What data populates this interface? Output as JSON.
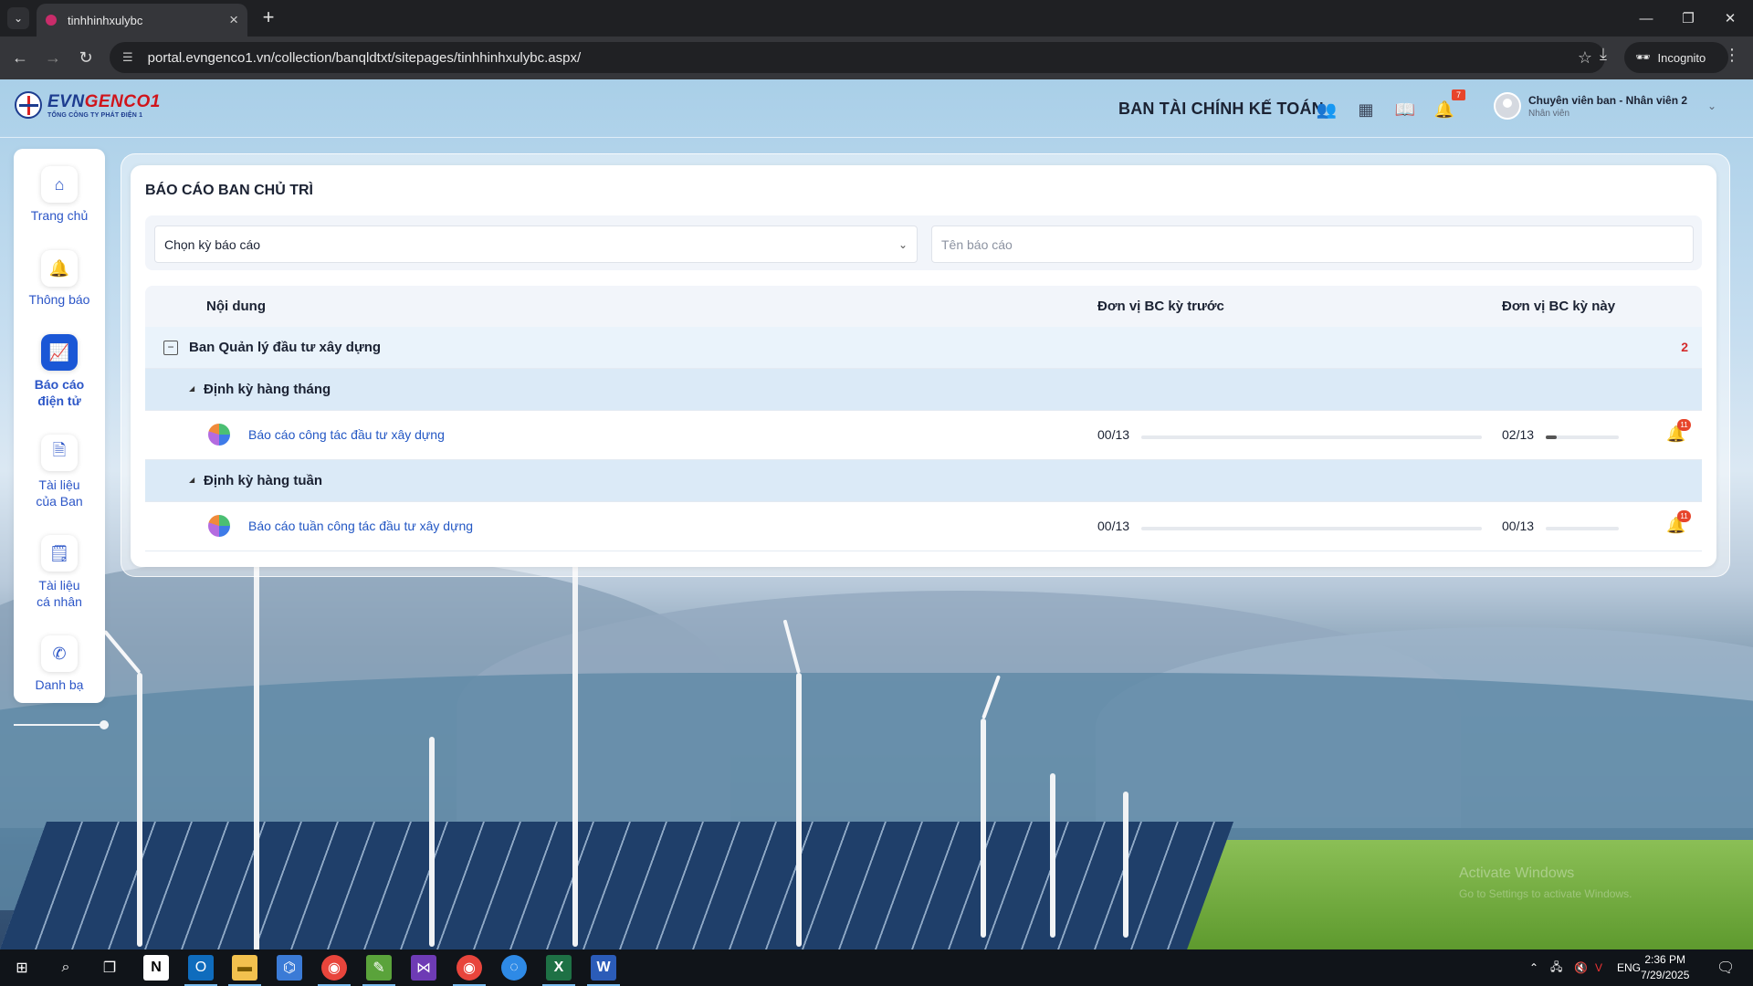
{
  "browser": {
    "tab_title": "tinhhinhxulybc",
    "url": "portal.evngenco1.vn/collection/banqldtxt/sitepages/tinhhinhxulybc.aspx/",
    "incognito_label": "Incognito"
  },
  "header": {
    "logo_evn": "EVN",
    "logo_genco": "GENCO1",
    "logo_sub": "TỔNG CÔNG TY PHÁT ĐIỆN 1",
    "department": "BAN TÀI CHÍNH KẾ TOÁN",
    "notification_count": "7",
    "user_name": "Chuyên viên ban - Nhân viên 2",
    "user_role": "Nhân viên"
  },
  "sidebar": {
    "items": [
      {
        "label": "Trang chủ",
        "icon": "home-icon"
      },
      {
        "label": "Thông báo",
        "icon": "bell-icon"
      },
      {
        "label": "Báo cáo điện tử",
        "icon": "chart-icon"
      },
      {
        "label": "Tài liệu của Ban",
        "icon": "document-icon"
      },
      {
        "label": "Tài liệu cá nhân",
        "icon": "note-icon"
      },
      {
        "label": "Danh bạ",
        "icon": "phone-icon"
      }
    ]
  },
  "main": {
    "title": "BÁO CÁO BAN CHỦ TRÌ",
    "period_select": "Chọn kỳ báo cáo",
    "search_placeholder": "Tên báo cáo",
    "columns": [
      "Nội dung",
      "Đơn vị BC kỳ trước",
      "Đơn vị BC kỳ này"
    ],
    "group": {
      "label": "Ban Quản lý đầu tư xây dựng",
      "count": "2",
      "toggle": "−"
    },
    "sections": [
      {
        "label": "Định kỳ hàng tháng",
        "item": {
          "name": "Báo cáo công tác đầu tư xây dựng",
          "prev": "00/13",
          "prev_progress": 0,
          "curr": "02/13",
          "curr_progress": 0.1538,
          "alert_count": "11"
        }
      },
      {
        "label": "Định kỳ hàng tuần",
        "item": {
          "name": "Báo cáo tuần công tác đầu tư xây dựng",
          "prev": "00/13",
          "prev_progress": 0,
          "curr": "00/13",
          "curr_progress": 0,
          "alert_count": "11"
        }
      }
    ]
  },
  "taskbar": {
    "lang": "ENG",
    "time": "2:36 PM",
    "date": "7/29/2025"
  },
  "windows_watermark": {
    "line1": "Activate Windows",
    "line2": "Go to Settings to activate Windows."
  },
  "colors": {
    "accent": "#1a57d6",
    "link": "#2357c4",
    "badge": "#e7452b"
  }
}
